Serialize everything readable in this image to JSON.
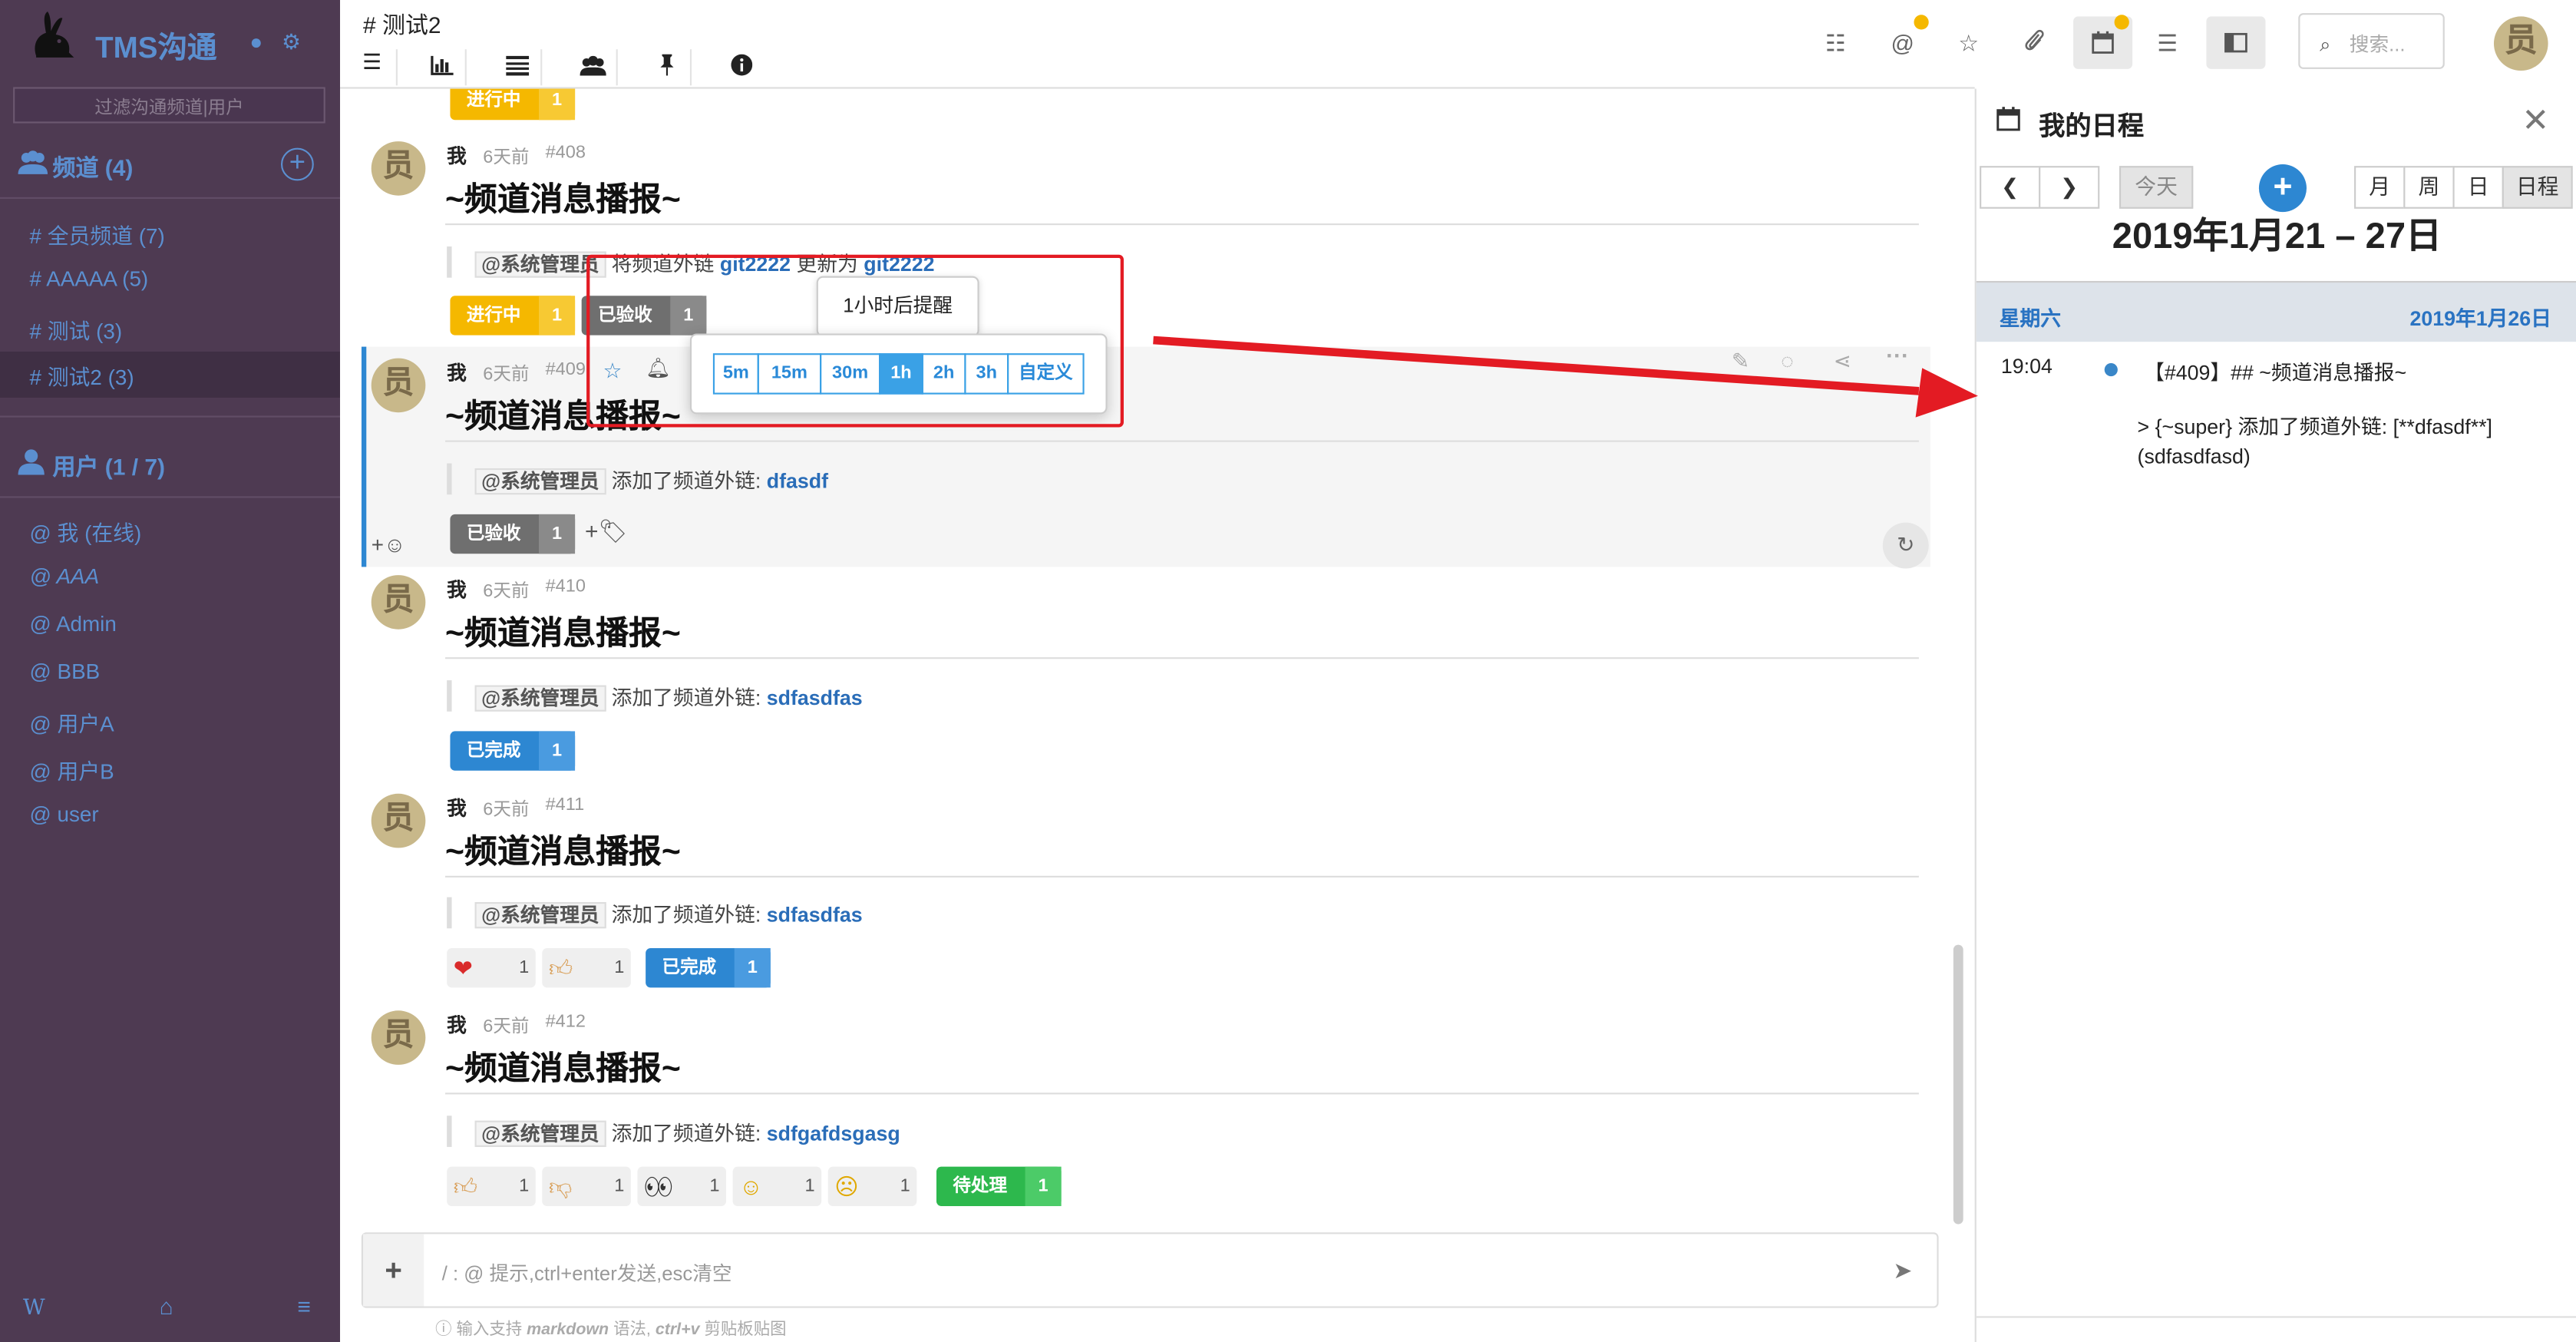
{
  "sidebar": {
    "brand": "TMS沟通",
    "filter_placeholder": "过滤沟通频道|用户",
    "channels_header": "频道 (4)",
    "channels": [
      {
        "label": "全员频道 (7)"
      },
      {
        "label": "AAAAA (5)"
      },
      {
        "label": "测试 (3)"
      },
      {
        "label": "测试2 (3)"
      }
    ],
    "users_header": "用户 (1 / 7)",
    "users": [
      {
        "label": "我 (在线)"
      },
      {
        "label": "AAA"
      },
      {
        "label": "Admin"
      },
      {
        "label": "BBB"
      },
      {
        "label": "用户A"
      },
      {
        "label": "用户B"
      },
      {
        "label": "user"
      }
    ],
    "footer_w": "W"
  },
  "header": {
    "channel_title": "# 测试2",
    "search_placeholder": "搜索..."
  },
  "messages": [
    {
      "author": "我",
      "time": "6天前",
      "id": "#408",
      "title": "~频道消息播报~",
      "mention": "@系统管理员",
      "text": "将频道外链",
      "link": "git2222",
      "text2": "更新为",
      "link2": "git2222"
    },
    {
      "author": "我",
      "time": "6天前",
      "id": "#409",
      "title": "~频道消息播报~",
      "mention": "@系统管理员",
      "text": "添加了频道外链:",
      "link": "dfasdf"
    },
    {
      "author": "我",
      "time": "6天前",
      "id": "#410",
      "title": "~频道消息播报~",
      "mention": "@系统管理员",
      "text": "添加了频道外链:",
      "link": "sdfasdfas"
    },
    {
      "author": "我",
      "time": "6天前",
      "id": "#411",
      "title": "~频道消息播报~",
      "mention": "@系统管理员",
      "text": "添加了频道外链:",
      "link": "sdfasdfas"
    },
    {
      "author": "我",
      "time": "6天前",
      "id": "#412",
      "title": "~频道消息播报~",
      "mention": "@系统管理员",
      "text": "添加了频道外链:",
      "link": "sdfgafdsgasg"
    }
  ],
  "badges": {
    "in_progress": "进行中",
    "accepted": "已验收",
    "done": "已完成",
    "pending": "待处理",
    "count": "1"
  },
  "reminder": {
    "tooltip": "1小时后提醒",
    "options": [
      "5m",
      "15m",
      "30m",
      "1h",
      "2h",
      "3h",
      "自定义"
    ],
    "selected": "1h"
  },
  "composer": {
    "placeholder": "/ : @ 提示,ctrl+enter发送,esc清空",
    "hint_a": "输入支持 ",
    "hint_b": "markdown",
    "hint_c": " 语法, ",
    "hint_d": "ctrl+v",
    "hint_e": " 剪贴板贴图"
  },
  "schedule": {
    "title": "我的日程",
    "today": "今天",
    "views": [
      "月",
      "周",
      "日",
      "日程"
    ],
    "active_view": "日程",
    "range": "2019年1月21 – 27日",
    "day_label": "星期六",
    "day_date": "2019年1月26日",
    "event_time": "19:04",
    "event_title": "【#409】## ~频道消息播报~",
    "event_body": "> {~super} 添加了频道外链: [**dfasdf**](sdfasdfasd)"
  },
  "colors": {
    "sidebar_bg": "#4e3a52",
    "accent": "#5b8fd0",
    "in_progress": "#f5b800",
    "accepted": "#777777",
    "done": "#2d87d2",
    "pending": "#2db84d",
    "annotation": "#e31b23"
  }
}
